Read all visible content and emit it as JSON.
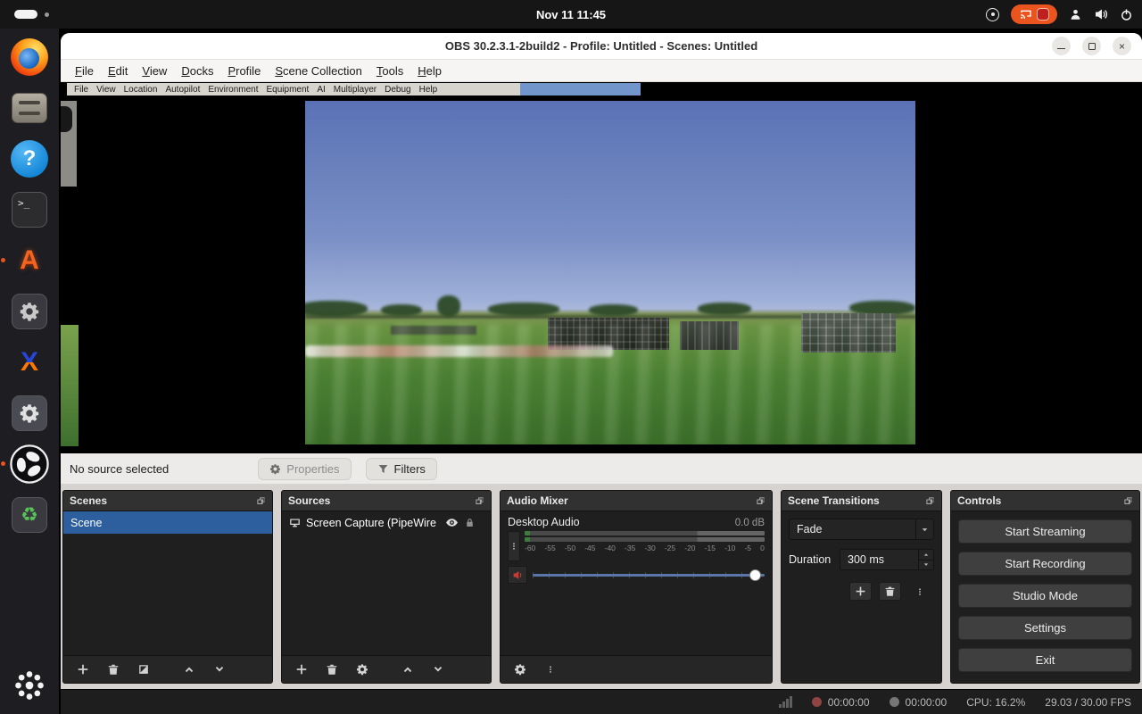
{
  "topbar": {
    "clock": "Nov 11 11:45"
  },
  "dock": {
    "items": [
      "firefox",
      "file-cabinet",
      "help",
      "terminal",
      "orange-a-app",
      "settings",
      "x-app",
      "tweaks-gear",
      "obs-studio",
      "software-recycler",
      "show-apps"
    ],
    "help_glyph": "?",
    "terminal_glyph": ">_",
    "a_glyph": "A",
    "x_glyph": "X",
    "recycle_glyph": "♻"
  },
  "window": {
    "title": "OBS 30.2.3.1-2build2 - Profile: Untitled - Scenes: Untitled"
  },
  "obs_menu": [
    "File",
    "Edit",
    "View",
    "Docks",
    "Profile",
    "Scene Collection",
    "Tools",
    "Help"
  ],
  "capture": {
    "menu": [
      "File",
      "View",
      "Location",
      "Autopilot",
      "Environment",
      "Equipment",
      "AI",
      "Multiplayer",
      "Debug",
      "Help"
    ]
  },
  "source_toolbar": {
    "status": "No source selected",
    "properties": "Properties",
    "filters": "Filters"
  },
  "scenes": {
    "header": "Scenes",
    "items": [
      {
        "label": "Scene",
        "selected": true
      }
    ]
  },
  "sources": {
    "header": "Sources",
    "items": [
      {
        "label": "Screen Capture (PipeWire",
        "visible": true,
        "locked": false
      }
    ]
  },
  "mixer": {
    "header": "Audio Mixer",
    "channel": {
      "name": "Desktop Audio",
      "level": "0.0 dB"
    },
    "ticks": [
      "-60",
      "-55",
      "-50",
      "-45",
      "-40",
      "-35",
      "-30",
      "-25",
      "-20",
      "-15",
      "-10",
      "-5",
      "0"
    ]
  },
  "transitions": {
    "header": "Scene Transitions",
    "selected": "Fade",
    "duration_label": "Duration",
    "duration_value": "300 ms"
  },
  "controls": {
    "header": "Controls",
    "buttons": [
      "Start Streaming",
      "Start Recording",
      "Studio Mode",
      "Settings",
      "Exit"
    ]
  },
  "statusbar": {
    "rec_time": "00:00:00",
    "stream_time": "00:00:00",
    "cpu": "CPU: 16.2%",
    "fps": "29.03 / 30.00 FPS"
  },
  "colors": {
    "selection_blue": "#2d5f9e",
    "ubuntu_orange": "#e95420",
    "screencast_pill": "#e9541f",
    "mute_red": "#c83a32",
    "panel_dark": "#1f1f1f",
    "titlebar_light": "#ffffff"
  }
}
